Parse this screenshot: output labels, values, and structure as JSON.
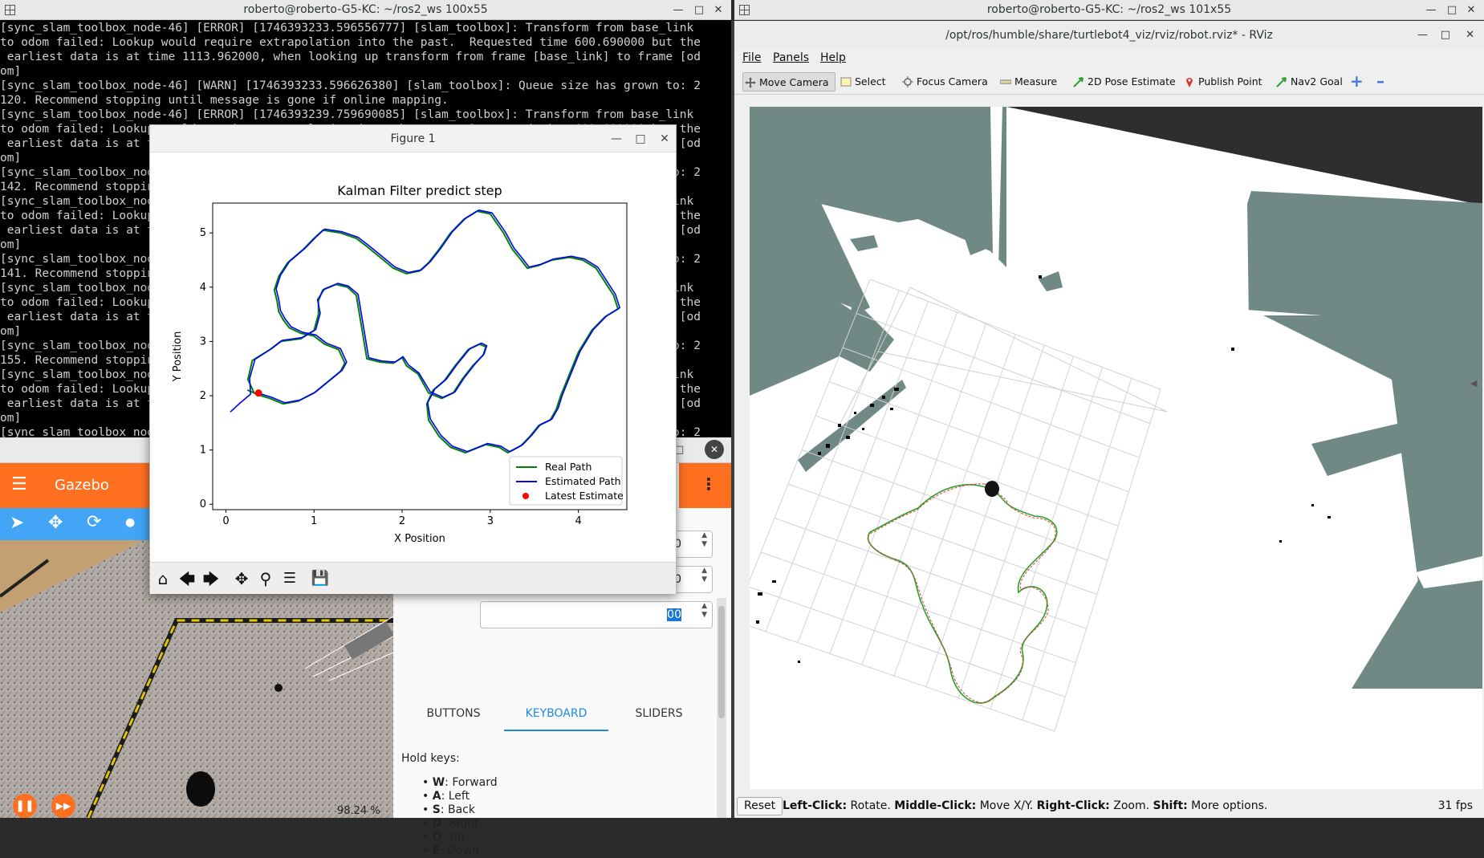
{
  "left_terminal": {
    "title": "roberto@roberto-G5-KC: ~/ros2_ws 100x55",
    "lines": [
      "[sync_slam_toolbox_node-46] [ERROR] [1746393233.596556777] [slam_toolbox]: Transform from base_link",
      "to odom failed: Lookup would require extrapolation into the past.  Requested time 600.690000 but the",
      " earliest data is at time 1113.962000, when looking up transform from frame [base_link] to frame [od",
      "om]",
      "[sync_slam_toolbox_node-46] [WARN] [1746393233.596626380] [slam_toolbox]: Queue size has grown to: 2",
      "120. Recommend stopping until message is gone if online mapping.",
      "[sync_slam_toolbox_node-46] [ERROR] [1746393239.759690085] [slam_toolbox]: Transform from base_link",
      "to odom failed: Lookup would require extrapolation into the past.  Requested time 600.690000 but the",
      " earliest data is at time 1113.962000, when looking up transform from frame [base_link] to frame [od",
      "om]",
      "[sync_slam_toolbox_node-46] [WARN] [1746393239.760001245] [slam_toolbox]: Queue size has grown to: 2",
      "142. Recommend stopping until message is gone if online mapping.",
      "[sync_slam_toolbox_node-46] [ERROR] [1746393242.102345678] [slam_toolbox]: Transform from base_link",
      "to odom failed: Lookup would require extrapolation into the past.  Requested time 600.690000 but the",
      " earliest data is at time 1113.962000, when looking up transform from frame [base_link] to frame [od",
      "om]",
      "[sync_slam_toolbox_node-46] [WARN] [1746393242.102999123] [slam_toolbox]: Queue size has grown to: 2",
      "141. Recommend stopping until message is gone if online mapping.",
      "[sync_slam_toolbox_node-46] [ERROR] [1746393245.331234567] [slam_toolbox]: Transform from base_link",
      "to odom failed: Lookup would require extrapolation into the past.  Requested time 600.690000 but the",
      " earliest data is at time 1113.962000, when looking up transform from frame [base_link] to frame [od",
      "om]",
      "[sync_slam_toolbox_node-46] [WARN] [1746393245.331876543] [slam_toolbox]: Queue size has grown to: 2",
      "155. Recommend stopping until message is gone if online mapping.",
      "[sync_slam_toolbox_node-46] [ERROR] [1746393248.871234567] [slam_toolbox]: Transform from base_link",
      "to odom failed: Lookup would require extrapolation into the past.  Requested time 600.690000 but the",
      " earliest data is at time 1113.962000, when looking up transform from frame [base_link] to frame [od",
      "om]",
      "[sync_slam_toolbox_node-46] [WARN] [1746393248.871999999] [slam_toolbox]: Queue size has grown to: 2"
    ]
  },
  "right_terminal": {
    "title": "roberto@roberto-G5-KC: ~/ros2_ws 101x55"
  },
  "figure": {
    "window_title": "Figure 1",
    "toolbar_icons": [
      "home-icon",
      "back-icon",
      "forward-icon",
      "pan-icon",
      "zoom-icon",
      "configure-icon",
      "save-icon"
    ]
  },
  "chart_data": {
    "type": "line",
    "title": "Kalman Filter predict step",
    "xlabel": "X Position",
    "ylabel": "Y Position",
    "xlim": [
      -0.15,
      4.55
    ],
    "ylim": [
      -0.1,
      5.55
    ],
    "xticks": [
      0,
      1,
      2,
      3,
      4
    ],
    "yticks": [
      0,
      1,
      2,
      3,
      4,
      5
    ],
    "legend_position": "lower-right",
    "series": [
      {
        "name": "Real Path",
        "color": "#008000",
        "x": [
          0.32,
          0.25,
          0.3,
          0.5,
          0.62,
          0.85,
          1.0,
          1.05,
          1.05,
          1.1,
          1.25,
          1.38,
          1.48,
          1.6,
          1.75,
          1.9,
          2.0,
          2.05,
          2.18,
          2.3,
          2.45,
          2.58,
          2.68,
          2.8,
          2.92,
          2.95,
          2.88,
          2.75,
          2.6,
          2.48,
          2.35,
          2.28,
          2.3,
          2.42,
          2.55,
          2.72,
          2.95,
          3.1,
          3.2,
          3.35,
          3.45,
          3.55,
          3.68,
          3.75,
          3.8,
          3.9,
          4.0,
          4.15,
          4.3,
          4.45,
          4.4,
          4.3,
          4.2,
          4.05,
          3.9,
          3.7,
          3.55,
          3.42,
          3.35,
          3.25,
          3.15,
          3.0,
          2.85,
          2.7,
          2.55,
          2.42,
          2.3,
          2.2,
          2.05,
          1.9,
          1.75,
          1.6,
          1.48,
          1.3,
          1.1,
          1.0,
          0.88,
          0.7,
          0.6,
          0.55,
          0.58,
          0.6,
          0.65,
          0.72,
          0.85,
          1.0,
          1.12,
          1.28,
          1.35,
          1.3,
          1.15,
          1.0,
          0.82,
          0.65,
          0.5,
          0.4,
          0.32,
          0.25,
          0.32
        ],
        "y": [
          2.05,
          2.3,
          2.65,
          2.85,
          3.0,
          3.05,
          3.2,
          3.5,
          3.75,
          3.95,
          4.05,
          4.0,
          3.85,
          2.68,
          2.62,
          2.6,
          2.7,
          2.55,
          2.4,
          2.05,
          1.95,
          2.05,
          2.3,
          2.55,
          2.75,
          2.9,
          2.95,
          2.85,
          2.55,
          2.28,
          2.1,
          1.85,
          1.55,
          1.25,
          1.05,
          0.95,
          1.1,
          1.05,
          0.95,
          1.08,
          1.25,
          1.45,
          1.55,
          1.75,
          2.0,
          2.4,
          2.8,
          3.2,
          3.45,
          3.6,
          3.85,
          4.1,
          4.35,
          4.5,
          4.55,
          4.5,
          4.4,
          4.35,
          4.5,
          4.7,
          5.0,
          5.35,
          5.4,
          5.25,
          5.0,
          4.7,
          4.45,
          4.3,
          4.25,
          4.35,
          4.55,
          4.75,
          4.9,
          5.0,
          5.05,
          4.9,
          4.7,
          4.45,
          4.2,
          3.95,
          3.75,
          3.55,
          3.4,
          3.25,
          3.15,
          3.1,
          2.95,
          2.85,
          2.6,
          2.45,
          2.25,
          2.05,
          1.9,
          1.85,
          1.95,
          2.0,
          2.05,
          2.1,
          2.05
        ]
      },
      {
        "name": "Estimated Path",
        "color": "#0000ff",
        "x": [
          0.05,
          0.15,
          0.28,
          0.27,
          0.33,
          0.52,
          0.64,
          0.86,
          1.02,
          1.07,
          1.04,
          1.12,
          1.27,
          1.39,
          1.5,
          1.62,
          1.77,
          1.92,
          2.01,
          2.07,
          2.19,
          2.32,
          2.46,
          2.6,
          2.7,
          2.82,
          2.93,
          2.96,
          2.9,
          2.77,
          2.62,
          2.5,
          2.37,
          2.29,
          2.32,
          2.44,
          2.57,
          2.74,
          2.97,
          3.12,
          3.22,
          3.37,
          3.47,
          3.57,
          3.7,
          3.77,
          3.82,
          3.92,
          4.02,
          4.17,
          4.32,
          4.47,
          4.42,
          4.32,
          4.22,
          4.07,
          3.92,
          3.72,
          3.57,
          3.44,
          3.37,
          3.27,
          3.17,
          3.02,
          2.87,
          2.72,
          2.57,
          2.44,
          2.32,
          2.22,
          2.07,
          1.92,
          1.77,
          1.62,
          1.5,
          1.32,
          1.12,
          1.02,
          0.9,
          0.72,
          0.62,
          0.57,
          0.6,
          0.62,
          0.67,
          0.74,
          0.87,
          1.02,
          1.14,
          1.3,
          1.37,
          1.32,
          1.17,
          1.02,
          0.84,
          0.67,
          0.52,
          0.42,
          0.34
        ],
        "y": [
          1.7,
          1.85,
          2.03,
          2.32,
          2.67,
          2.87,
          3.02,
          3.07,
          3.22,
          3.52,
          3.77,
          3.97,
          4.07,
          4.02,
          3.87,
          2.7,
          2.64,
          2.62,
          2.72,
          2.57,
          2.42,
          2.07,
          1.97,
          2.07,
          2.32,
          2.57,
          2.77,
          2.92,
          2.97,
          2.87,
          2.57,
          2.3,
          2.12,
          1.87,
          1.57,
          1.27,
          1.07,
          0.97,
          1.12,
          1.07,
          0.97,
          1.1,
          1.27,
          1.47,
          1.57,
          1.77,
          2.02,
          2.42,
          2.82,
          3.22,
          3.47,
          3.62,
          3.87,
          4.12,
          4.37,
          4.52,
          4.57,
          4.52,
          4.42,
          4.37,
          4.52,
          4.72,
          5.02,
          5.37,
          5.42,
          5.27,
          5.02,
          4.72,
          4.47,
          4.32,
          4.27,
          4.37,
          4.57,
          4.77,
          4.92,
          5.02,
          5.07,
          4.92,
          4.72,
          4.47,
          4.22,
          3.97,
          3.77,
          3.57,
          3.42,
          3.27,
          3.17,
          3.12,
          2.97,
          2.87,
          2.62,
          2.47,
          2.27,
          2.07,
          1.92,
          1.87,
          1.97,
          2.02,
          2.07
        ]
      },
      {
        "name": "Latest Estimate",
        "color": "#ff0000",
        "x": [
          0.37
        ],
        "y": [
          2.05
        ]
      }
    ]
  },
  "gazebo": {
    "title": "Gazebo",
    "numbers": [
      "50",
      "00",
      "00"
    ],
    "tabs": [
      "BUTTONS",
      "KEYBOARD",
      "SLIDERS"
    ],
    "hold_keys_label": "Hold keys:",
    "keys": [
      {
        "key": "W",
        "action": ": Forward"
      },
      {
        "key": "A",
        "action": ": Left"
      },
      {
        "key": "S",
        "action": ": Back"
      },
      {
        "key": "D",
        "action": ": Right"
      },
      {
        "key": "Q",
        "action": ": Up"
      },
      {
        "key": "E",
        "action": ": Down"
      }
    ],
    "rtf": "98.24 %",
    "accent": "#ff6f20",
    "toolbar_color": "#42a5f5"
  },
  "rviz": {
    "title": "/opt/ros/humble/share/turtlebot4_viz/rviz/robot.rviz* - RViz",
    "menu": [
      "File",
      "Panels",
      "Help"
    ],
    "tools": [
      "Move Camera",
      "Select",
      "Focus Camera",
      "Measure",
      "2D Pose Estimate",
      "Publish Point",
      "Nav2 Goal"
    ],
    "reset_label": "Reset",
    "status": {
      "left_click": "Left-Click:",
      "left_action": " Rotate. ",
      "middle_click": "Middle-Click:",
      "middle_action": " Move X/Y. ",
      "right_click": "Right-Click:",
      "right_action": " Zoom. ",
      "shift": "Shift:",
      "shift_action": " More options."
    },
    "fps": "31 fps"
  }
}
